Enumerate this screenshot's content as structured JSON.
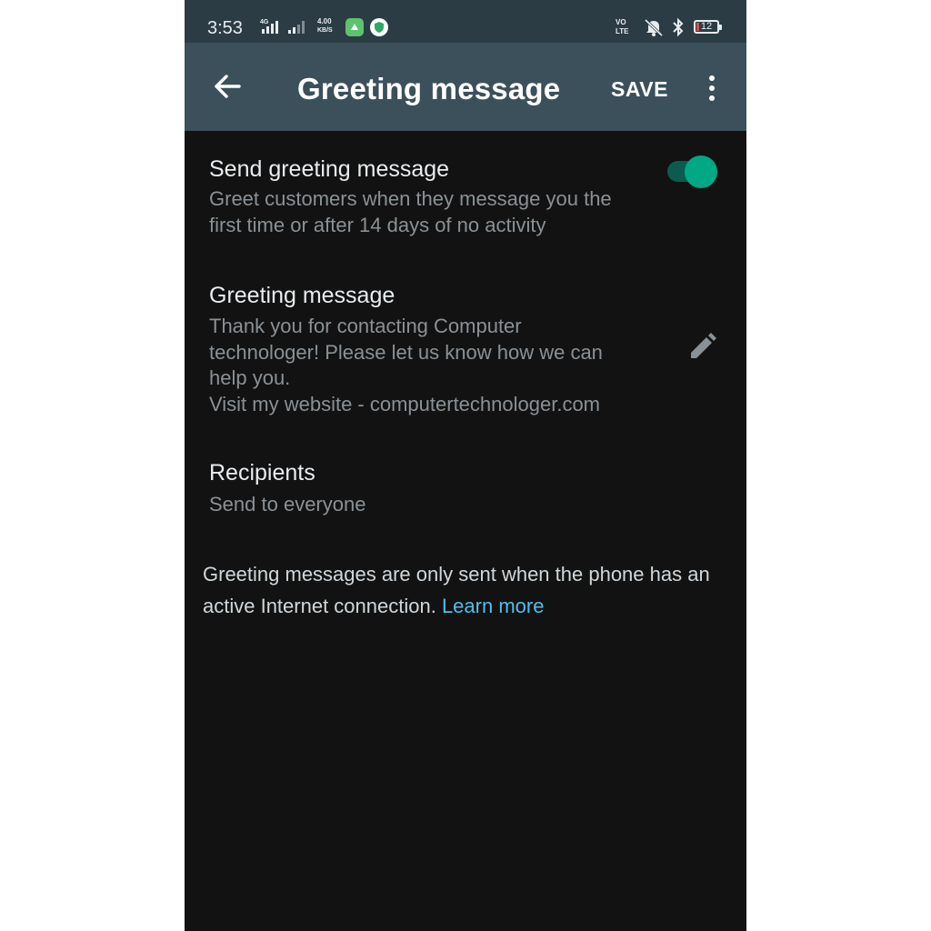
{
  "status_bar": {
    "time": "3:53",
    "network_type": "4G",
    "data_speed_value": "4.00",
    "data_speed_unit": "KB/S",
    "volte_top": "VO",
    "volte_bottom": "LTE",
    "battery_level": "12",
    "icons": [
      "signal-bars-icon",
      "app-notification-icon",
      "vpn-shield-icon",
      "volte-icon",
      "vibrate-icon",
      "bluetooth-icon",
      "battery-icon"
    ]
  },
  "app_bar": {
    "title": "Greeting message",
    "save_label": "SAVE",
    "back_icon": "arrow-left-icon",
    "menu_icon": "more-vert-icon"
  },
  "settings": {
    "send_greeting": {
      "title": "Send greeting message",
      "subtitle": "Greet customers when they message you the\nfirst time or after 14 days of no activity",
      "enabled": true
    },
    "greeting_message": {
      "title": "Greeting message",
      "text": "Thank you for contacting Computer\ntechnologer! Please let us know how we can\nhelp you.\nVisit my website - computertechnologer.com",
      "edit_icon": "pencil-icon"
    },
    "recipients": {
      "title": "Recipients",
      "subtitle": "Send to everyone"
    }
  },
  "footnote": {
    "text": "Greeting messages are only sent when the phone has an active Internet connection. ",
    "link": "Learn more"
  },
  "colors": {
    "status_bar": "#2c3c45",
    "app_bar": "#3c505b",
    "background": "#121212",
    "accent": "#00a884",
    "link": "#53bdeb"
  }
}
